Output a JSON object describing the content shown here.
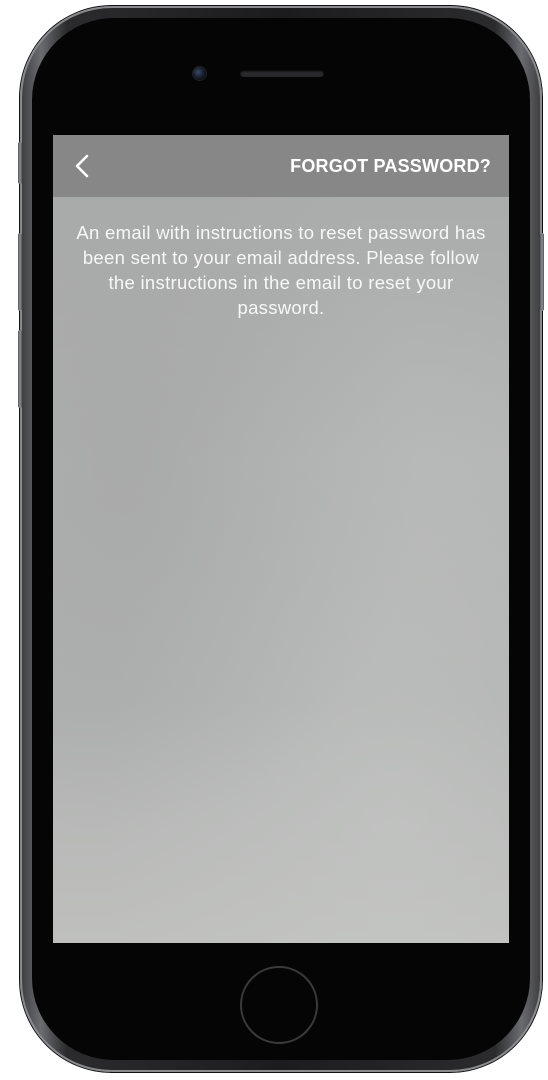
{
  "device": {
    "model_hint": "smartphone"
  },
  "nav": {
    "title": "FORGOT PASSWORD?",
    "back_icon": "chevron-left-icon"
  },
  "content": {
    "message": "An email with instructions to reset password has been sent to your email address. Please follow the instructions in the email to reset your password."
  },
  "colors": {
    "nav_background": "#878787",
    "screen_background": "#b1b2b2",
    "text": "#ffffff"
  }
}
